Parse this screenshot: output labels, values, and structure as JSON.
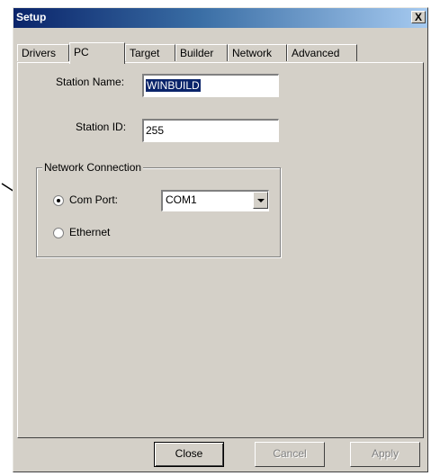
{
  "window": {
    "title": "Setup",
    "close_glyph": "X"
  },
  "tabs": [
    {
      "label": "Drivers",
      "active": false
    },
    {
      "label": "PC",
      "active": true
    },
    {
      "label": "Target",
      "active": false
    },
    {
      "label": "Builder",
      "active": false
    },
    {
      "label": "Network",
      "active": false
    },
    {
      "label": "Advanced",
      "active": false
    }
  ],
  "pc_tab": {
    "station_name_label": "Station Name:",
    "station_name_value": "WINBUILD",
    "station_id_label": "Station ID:",
    "station_id_value": "255",
    "network_group_label": "Network Connection",
    "com_port_label": "Com Port:",
    "com_port_selected": true,
    "com_port_value": "COM1",
    "ethernet_label": "Ethernet",
    "ethernet_selected": false
  },
  "buttons": {
    "close": "Close",
    "cancel": "Cancel",
    "apply": "Apply"
  },
  "annotation": {
    "arrow_icon": "arrow-right-icon"
  },
  "colors": {
    "titlebar_start": "#0a246a",
    "titlebar_end": "#a6caf0",
    "face": "#d4d0c8",
    "selection": "#0a246a"
  }
}
